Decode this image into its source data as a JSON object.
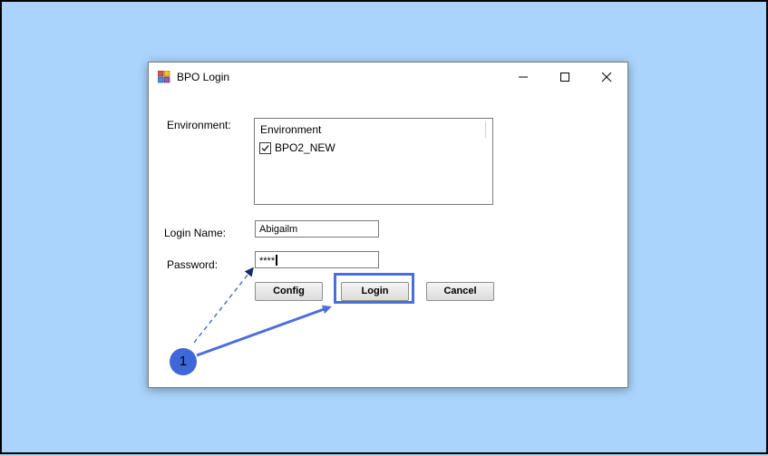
{
  "window": {
    "title": "BPO Login",
    "controls": {
      "minimize": "minimize",
      "maximize": "maximize",
      "close": "close"
    }
  },
  "form": {
    "environment_label": "Environment:",
    "environment_list": {
      "header": "Environment",
      "items": [
        {
          "label": "BPO2_NEW",
          "checked": true
        }
      ]
    },
    "login_name_label": "Login Name:",
    "login_name_value": "Abigailm",
    "password_label": "Password:",
    "password_value": "****"
  },
  "buttons": {
    "config": "Config",
    "login": "Login",
    "cancel": "Cancel"
  },
  "annotation": {
    "step_number": "1",
    "accent_color": "#4a6fdc"
  }
}
